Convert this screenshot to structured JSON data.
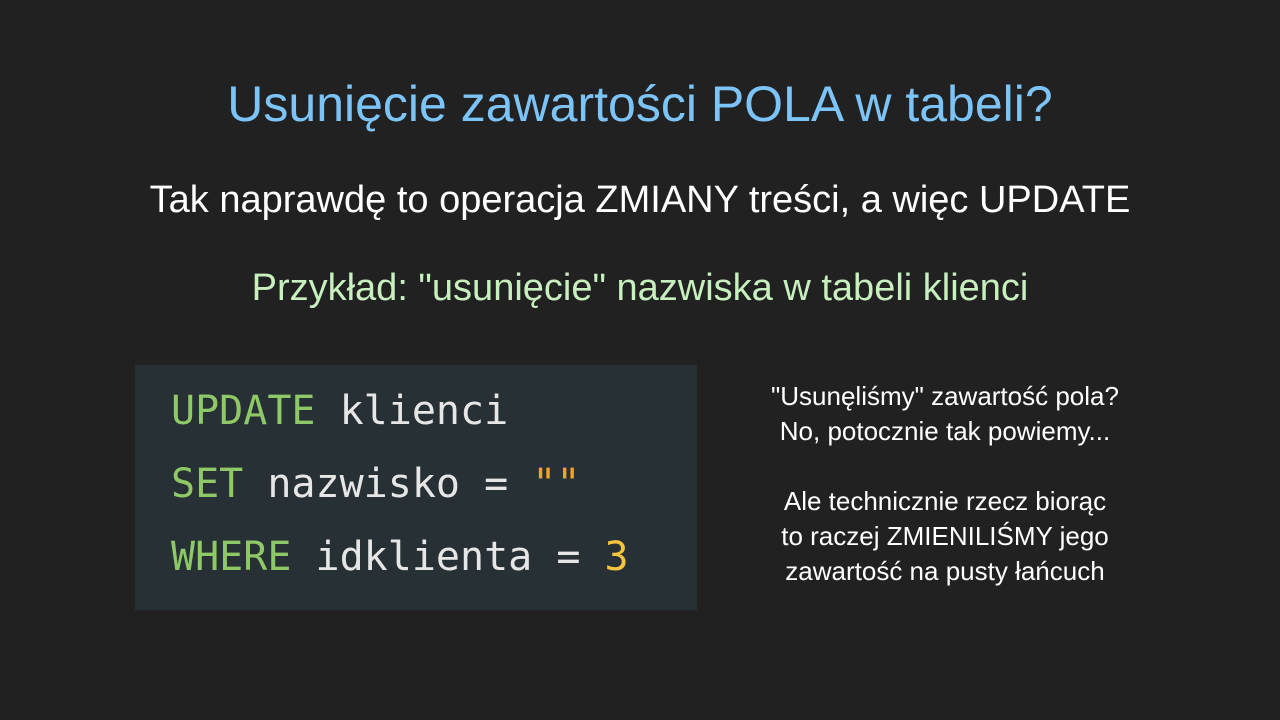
{
  "slide": {
    "title": "Usunięcie zawartości POLA w tabeli?",
    "subtitle": "Tak naprawdę to operacja ZMIANY treści, a więc UPDATE",
    "example": "Przykład: \"usunięcie\" nazwiska w tabeli klienci"
  },
  "code": {
    "line1": {
      "keyword": "UPDATE",
      "rest": " klienci"
    },
    "line2": {
      "keyword": "SET",
      "column": " nazwisko",
      "operator": " = ",
      "value": "\"\""
    },
    "line3": {
      "keyword": "WHERE",
      "column": " idklienta",
      "operator": " = ",
      "value": "3"
    }
  },
  "notes": {
    "note1": [
      "\"Usunęliśmy\" zawartość pola?",
      "No, potocznie tak powiemy..."
    ],
    "note2": [
      "Ale technicznie rzecz biorąc",
      "to raczej ZMIENILIŚMY jego",
      "zawartość na pusty łańcuch"
    ]
  },
  "colors": {
    "background": "#212121",
    "title": "#7cc4f7",
    "example": "#c8f0bf",
    "code_background": "#263035",
    "keyword": "#8fc866",
    "string": "#f0a229",
    "number": "#f5c43c"
  }
}
